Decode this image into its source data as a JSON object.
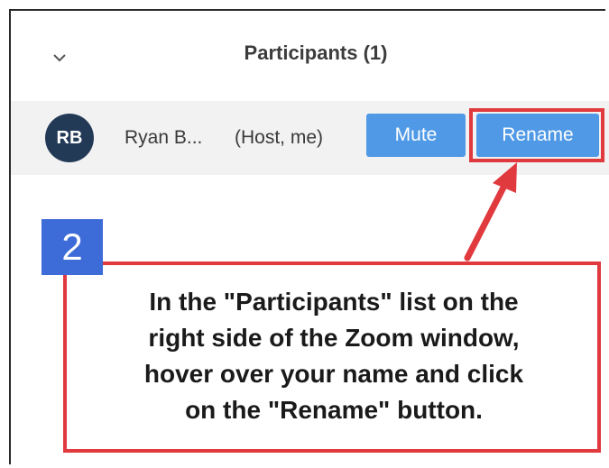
{
  "panel": {
    "title": "Participants (1)",
    "chevron_icon": "chevron-down-icon"
  },
  "participant": {
    "initials": "RB",
    "name": "Ryan B...",
    "role": "(Host, me)",
    "avatar_color": "#233a57",
    "mute_label": "Mute",
    "rename_label": "Rename"
  },
  "callout": {
    "step": "2",
    "lines": [
      "In the \"Participants\" list on the",
      "right side of the Zoom window,",
      "hover over your name and click",
      "on the \"Rename\" button."
    ],
    "highlight_color": "#e0393e",
    "badge_color": "#3d6bd8"
  }
}
